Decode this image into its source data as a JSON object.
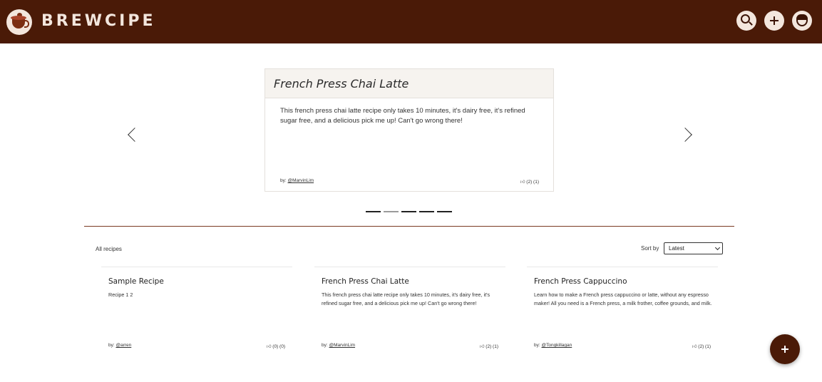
{
  "header": {
    "brand": "BREWCIPE",
    "logo_icon": "coffee-cup-icon",
    "actions": [
      {
        "name": "search",
        "icon": "search-icon"
      },
      {
        "name": "add",
        "icon": "plus-icon"
      },
      {
        "name": "profile",
        "icon": "user-avatar-icon"
      }
    ],
    "background_color": "#4a1a07"
  },
  "carousel": {
    "featured": {
      "title": "French Press Chai Latte",
      "description": "This french press chai latte recipe only takes 10 minutes, it's dairy free, it's refined sugar free, and a delicious pick me up! Can't go wrong there!",
      "by_label": "by:",
      "author": "@MarvinLim",
      "votes": "(2) (1)"
    },
    "indicator_count": 5,
    "active_indicator": 2
  },
  "recipes": {
    "section_label": "All recipes",
    "sort_label": "Sort by",
    "sort_value": "Latest",
    "items": [
      {
        "title": "Sample Recipe",
        "description": "Recipe 1 2",
        "by_label": "by:",
        "author": "@arren",
        "votes": "(0) (0)"
      },
      {
        "title": "French Press Chai Latte",
        "description": "This french press chai latte recipe only takes 10 minutes, it's dairy free, it's refined sugar free, and a delicious pick me up! Can't go wrong there!",
        "by_label": "by:",
        "author": "@MarvinLim",
        "votes": "(2) (1)"
      },
      {
        "title": "French Press Cappuccino",
        "description": "Learn how to make a French press cappuccino or latte, without any espresso maker! All you need is a French press, a milk frother, coffee grounds, and milk.",
        "by_label": "by:",
        "author": "@Tongkillagan",
        "votes": "(2) (1)"
      }
    ]
  },
  "fab": {
    "icon": "plus-icon",
    "label": "+"
  }
}
